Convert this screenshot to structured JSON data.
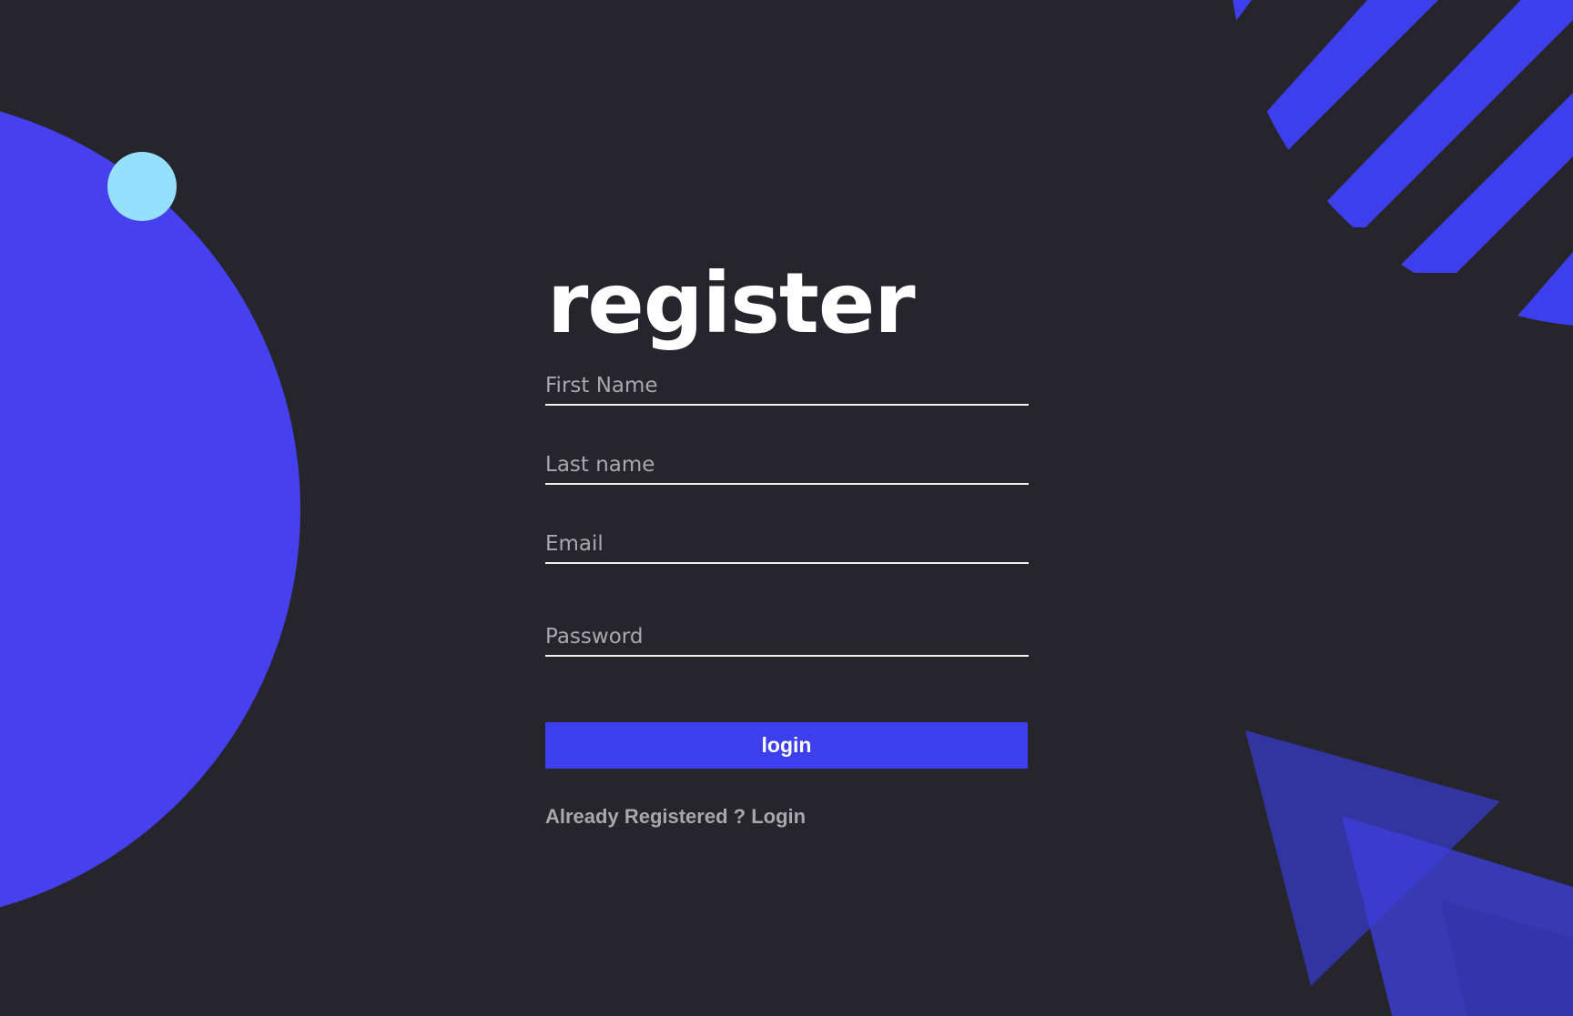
{
  "page": {
    "title": "register",
    "colors": {
      "background": "#26252c",
      "accent": "#3e3fec",
      "circle": "#4640ee",
      "dot": "#95e0fe",
      "triangle": "#3336a8"
    }
  },
  "form": {
    "first_name": {
      "placeholder": "First Name",
      "value": ""
    },
    "last_name": {
      "placeholder": "Last name",
      "value": ""
    },
    "email": {
      "placeholder": "Email",
      "value": ""
    },
    "password": {
      "placeholder": "Password",
      "value": ""
    },
    "submit_label": "login",
    "login_link_text": "Already Registered ? Login"
  }
}
